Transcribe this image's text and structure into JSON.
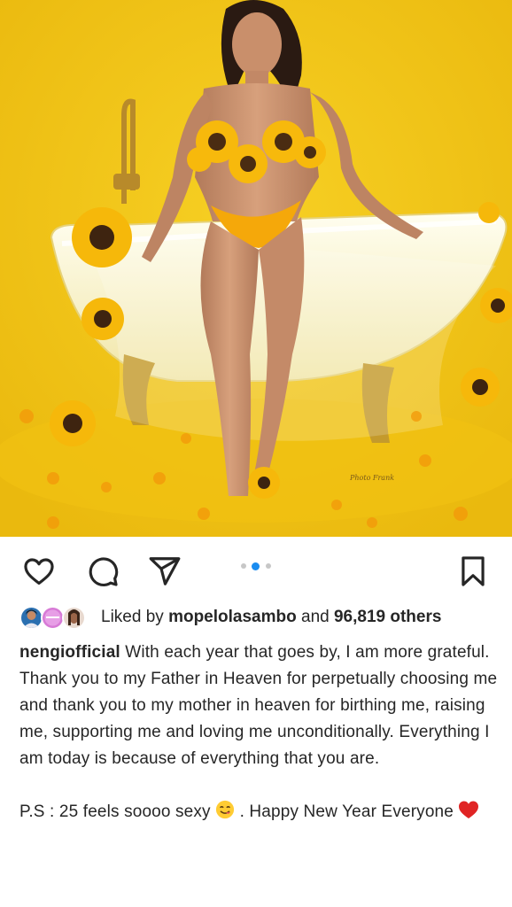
{
  "post": {
    "username": "nengiofficial",
    "caption_main": "With each year that goes by, I am more grateful. Thank you to my Father in Heaven for perpetually choosing me and thank you to my mother in heaven for birthing me, raising me, supporting me and loving me unconditionally. Everything I am today is because of everything that you are.",
    "caption_ps_1": "P.S : 25 feels soooo sexy",
    "caption_ps_2": ". Happy New Year Everyone",
    "photo_watermark": "Photo Frank"
  },
  "likes": {
    "prefix": "Liked by",
    "user": "mopelolasambo",
    "middle": "and",
    "others": "96,819 others"
  },
  "icons": {
    "like": "heart-outline-icon",
    "comment": "comment-bubble-icon",
    "share": "paper-plane-icon",
    "save": "bookmark-icon"
  },
  "carousel": {
    "slide_count": 3,
    "active_index": 1
  },
  "colors": {
    "photo_background": "#f3c416",
    "accent_blue": "#1a8cf0",
    "heart_red": "#e02424",
    "text": "#262626"
  }
}
